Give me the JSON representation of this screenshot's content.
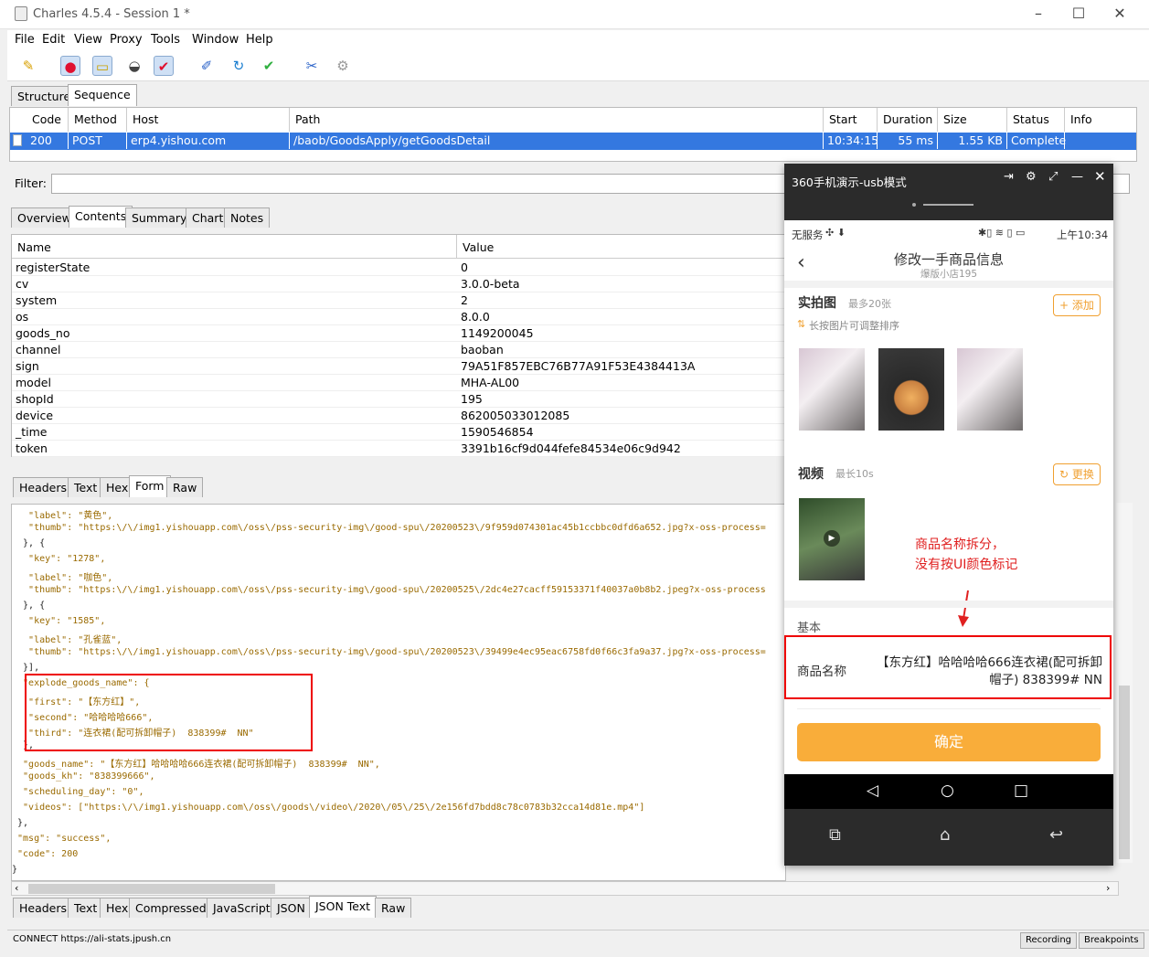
{
  "window": {
    "title": "Charles 4.5.4 - Session 1 *"
  },
  "menu": [
    "File",
    "Edit",
    "View",
    "Proxy",
    "Tools",
    "Window",
    "Help"
  ],
  "view_tabs": [
    "Structure",
    "Sequence"
  ],
  "sequence": {
    "headers": [
      "Code",
      "Method",
      "Host",
      "Path",
      "Start",
      "Duration",
      "Size",
      "Status",
      "Info"
    ],
    "row": {
      "code": "200",
      "method": "POST",
      "host": "erp4.yishou.com",
      "path": "/baob/GoodsApply/getGoodsDetail",
      "start": "10:34:15",
      "duration": "55 ms",
      "size": "1.55 KB",
      "status": "Complete",
      "info": ""
    }
  },
  "filter": {
    "label": "Filter:"
  },
  "detail_tabs": [
    "Overview",
    "Contents",
    "Summary",
    "Chart",
    "Notes"
  ],
  "params": {
    "headers": [
      "Name",
      "Value"
    ],
    "rows": [
      [
        "registerState",
        "0"
      ],
      [
        "cv",
        "3.0.0-beta"
      ],
      [
        "system",
        "2"
      ],
      [
        "os",
        "8.0.0"
      ],
      [
        "goods_no",
        "1149200045"
      ],
      [
        "channel",
        "baoban"
      ],
      [
        "sign",
        "79A51F857EBC76B77A91F53E4384413A"
      ],
      [
        "model",
        "MHA-AL00"
      ],
      [
        "shopId",
        "195"
      ],
      [
        "device",
        "862005033012085"
      ],
      [
        "_time",
        "1590546854"
      ],
      [
        "token",
        "3391b16cf9d044fefe84534e06c9d942"
      ]
    ]
  },
  "request_tabs": [
    "Headers",
    "Text",
    "Hex",
    "Form",
    "Raw"
  ],
  "json_lines": [
    "   \"label\": \"黄色\",",
    "   \"thumb\": \"https:\\/\\/img1.yishouapp.com\\/oss\\/pss-security-img\\/good-spu\\/20200523\\/9f959d074301ac45b1ccbbc0dfd6a652.jpg?x-oss-process=",
    "  }, {",
    "   \"key\": \"1278\",",
    "   \"label\": \"咖色\",",
    "   \"thumb\": \"https:\\/\\/img1.yishouapp.com\\/oss\\/pss-security-img\\/good-spu\\/20200525\\/2dc4e27cacff59153371f40037a0b8b2.jpeg?x-oss-process",
    "  }, {",
    "   \"key\": \"1585\",",
    "   \"label\": \"孔雀蓝\",",
    "   \"thumb\": \"https:\\/\\/img1.yishouapp.com\\/oss\\/pss-security-img\\/good-spu\\/20200523\\/39499e4ec95eac6758fd0f66c3fa9a37.jpg?x-oss-process=",
    "  }],",
    "  \"explode_goods_name\": {",
    "   \"first\": \"【东方红】\",",
    "   \"second\": \"哈哈哈哈666\",",
    "   \"third\": \"连衣裙(配可拆卸帽子)  838399#  NN\"",
    "  },",
    "  \"goods_name\": \"【东方红】哈哈哈哈666连衣裙(配可拆卸帽子)  838399#  NN\",",
    "  \"goods_kh\": \"838399666\",",
    "  \"scheduling_day\": \"0\",",
    "  \"videos\": [\"https:\\/\\/img1.yishouapp.com\\/oss\\/goods\\/video\\/2020\\/05\\/25\\/2e156fd7bdd8c78c0783b32cca14d81e.mp4\"]",
    " },",
    " \"msg\": \"success\",",
    " \"code\": 200",
    "}"
  ],
  "response_tabs": [
    "Headers",
    "Text",
    "Hex",
    "Compressed",
    "JavaScript",
    "JSON",
    "JSON Text",
    "Raw"
  ],
  "statusbar": {
    "text": "CONNECT https://ali-stats.jpush.cn",
    "recording": "Recording",
    "breakpoints": "Breakpoints"
  },
  "phone": {
    "window_title": "360手机演示-usb模式",
    "status_left": "无服务",
    "status_time": "上午10:34",
    "page_title": "修改一手商品信息",
    "page_subtitle": "爆版小店195",
    "photos_label": "实拍图",
    "photos_hint": "最多20张",
    "photos_add": "+ 添加",
    "photos_tip": "长按图片可调整排序",
    "video_label": "视频",
    "video_hint": "最长10s",
    "video_change": "更换",
    "annotation_line1": "商品名称拆分，",
    "annotation_line2": "没有按UI颜色标记",
    "basic_label": "基本",
    "name_label": "商品名称",
    "name_line1": "【东方红】哈哈哈哈666连衣裙(配可拆卸",
    "name_line2": "帽子) 838399#  NN",
    "confirm": "确定"
  }
}
